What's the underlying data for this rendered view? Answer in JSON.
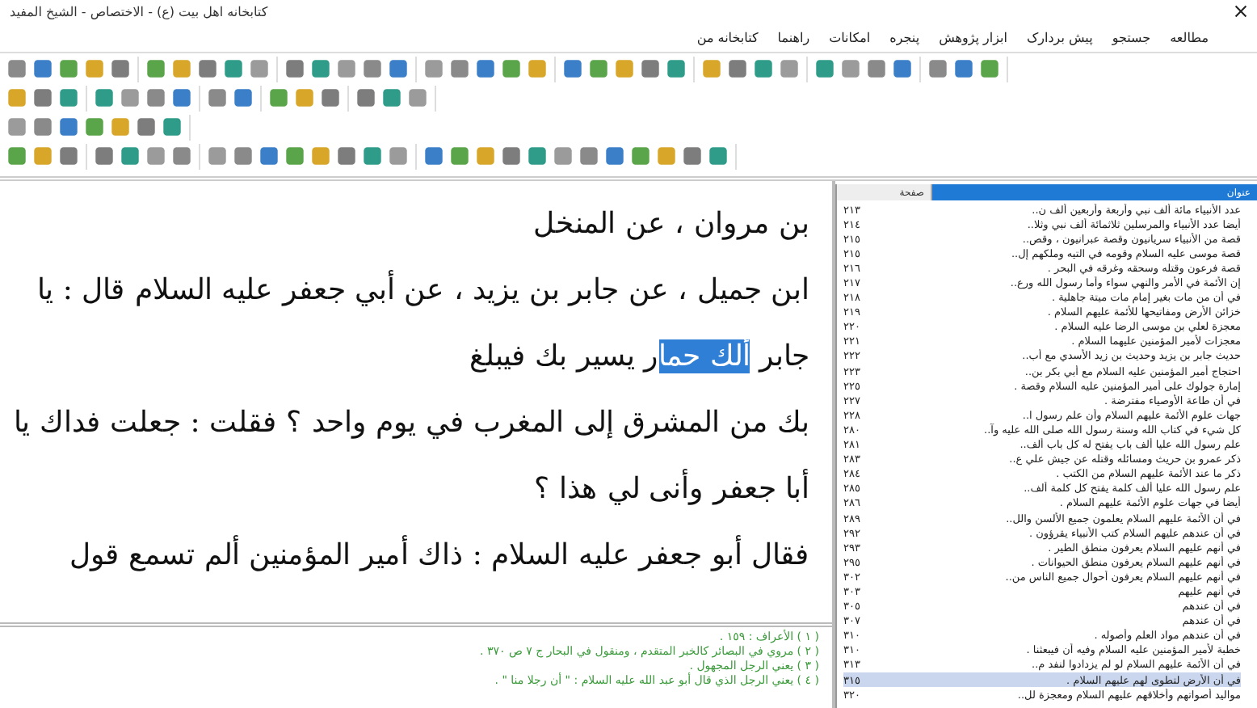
{
  "window": {
    "title": "کتابخانه اهل بیت (ع) - الاختصاص - الشیخ المفید"
  },
  "menu": [
    "مطالعه",
    "جستجو",
    "پیش بردارک",
    "ابزار پژوهش",
    "پنجره",
    "امکانات",
    "راهنما",
    "کتابخانه من"
  ],
  "reader": {
    "lines": [
      [
        {
          "text": "بن مروان ، عن المنخل",
          "selected": false
        }
      ],
      [
        {
          "text": "ابن جميل ، عن جابر بن يزيد ، عن أبي جعفر عليه السلام قال : يا",
          "selected": false
        }
      ],
      [
        {
          "text": "جابر ",
          "selected": false
        },
        {
          "text": "ألك حما",
          "selected": true
        },
        {
          "text": "ر يسير بك فيبلغ",
          "selected": false
        }
      ],
      [
        {
          "text": "بك من المشرق إلى المغرب في يوم واحد ؟ فقلت : جعلت فداك يا",
          "selected": false
        }
      ],
      [
        {
          "text": "أبا جعفر وأنى لي هذا ؟",
          "selected": false
        }
      ],
      [
        {
          "text": "فقال أبو جعفر عليه السلام : ذاك أمير المؤمنين ألم تسمع قول",
          "selected": false
        }
      ]
    ]
  },
  "footnotes": [
    "( ١ ) الأعراف : ١٥٩ .",
    "( ٢ ) مروي في البصائر كالخبر المتقدم ، ومنقول في البحار ج ٧ ص ٣٧٠ .",
    "( ٣ ) يعني الرجل المجهول .",
    "( ٤ ) يعني الرجل الذي قال أبو عبد الله عليه السلام : \" أن رجلا منا \" ."
  ],
  "contents": {
    "columns": [
      "عنوان",
      "صفحة"
    ],
    "rows": [
      {
        "title": "عدد الأنبياء مائة ألف نبي وأربعة وأربعين ألف ن..",
        "page": "٢١٣",
        "selected": false
      },
      {
        "title": "أيضا عدد الأنبياء والمرسلين ثلاثمائة ألف نبي وثلا..",
        "page": "٢١٤",
        "selected": false
      },
      {
        "title": "قصة من الأنبياء سريانيون وقصة عبرانيون ، وقص..",
        "page": "٢١٥",
        "selected": false
      },
      {
        "title": "قصة موسى عليه السلام وقومه في التيه وملكهم إل..",
        "page": "٢١٥",
        "selected": false
      },
      {
        "title": "قصة فرعون وقتله وسحقه وغرقه في البحر .",
        "page": "٢١٦",
        "selected": false
      },
      {
        "title": "إن الأئمة في الأمر والنهي سواء وأما رسول الله ورع..",
        "page": "٢١٧",
        "selected": false
      },
      {
        "title": "في أن من مات بغير إمام مات ميتة جاهلية .",
        "page": "٢١٨",
        "selected": false
      },
      {
        "title": "خزائن الأرض ومفاتيحها للأئمة عليهم السلام .",
        "page": "٢١٩",
        "selected": false
      },
      {
        "title": "معجزة لعلي بن موسى الرضا عليه السلام .",
        "page": "٢٢٠",
        "selected": false
      },
      {
        "title": "معجزات لأمير المؤمنين عليهما السلام .",
        "page": "٢٢١",
        "selected": false
      },
      {
        "title": "حديث جابر بن يزيد وحديث بن زيد الأسدي مع أب..",
        "page": "٢٢٢",
        "selected": false
      },
      {
        "title": "احتجاج أمير المؤمنين عليه السلام مع أبي بكر بن..",
        "page": "٢٢٣",
        "selected": false
      },
      {
        "title": "إمارة جولوك على أمير المؤمنين عليه السلام وقصة .",
        "page": "٢٢٥",
        "selected": false
      },
      {
        "title": "في أن طاعة الأوصياء مفترضة .",
        "page": "٢٢٧",
        "selected": false
      },
      {
        "title": "جهات علوم الأئمة عليهم السلام وأن علم رسول ا..",
        "page": "٢٢٨",
        "selected": false
      },
      {
        "title": "كل شيء في كتاب الله وسنة رسول الله صلى الله عليه وآ..",
        "page": "٢٨٠",
        "selected": false
      },
      {
        "title": "علم رسول الله عليا ألف باب يفتح له كل باب ألف..",
        "page": "٢٨١",
        "selected": false
      },
      {
        "title": "ذكر عمرو بن حريث ومسائله وقتله عن جيش علي ع..",
        "page": "٢٨٣",
        "selected": false
      },
      {
        "title": "ذكر ما عند الأئمة عليهم السلام من الكتب .",
        "page": "٢٨٤",
        "selected": false
      },
      {
        "title": "علم رسول الله عليا ألف كلمة يفتح كل كلمة ألف..",
        "page": "٢٨٥",
        "selected": false
      },
      {
        "title": "أيضا في جهات علوم الأئمة عليهم السلام .",
        "page": "٢٨٦",
        "selected": false
      },
      {
        "title": "في أن الأئمة عليهم السلام يعلمون جميع الألسن والل..",
        "page": "٢٨٩",
        "selected": false
      },
      {
        "title": "في أن عندهم عليهم السلام كتب الأنبياء يقرؤون .",
        "page": "٢٩٢",
        "selected": false
      },
      {
        "title": "في أنهم عليهم السلام يعرفون منطق الطير .",
        "page": "٢٩٣",
        "selected": false
      },
      {
        "title": "في أنهم عليهم السلام يعرفون منطق الحيوانات .",
        "page": "٢٩٥",
        "selected": false
      },
      {
        "title": "في أنهم عليهم السلام يعرفون أحوال جميع الناس من..",
        "page": "٣٠٢",
        "selected": false
      },
      {
        "title": "في أنهم عليهم",
        "page": "٣٠٣",
        "selected": false
      },
      {
        "title": "في أن عندهم",
        "page": "٣٠٥",
        "selected": false
      },
      {
        "title": "في أن عندهم",
        "page": "٣٠٧",
        "selected": false
      },
      {
        "title": "في أن عندهم مواد العلم وأصوله .",
        "page": "٣١٠",
        "selected": false
      },
      {
        "title": "خطبة لأمير المؤمنين عليه السلام وفيه أن فيبعثنا .",
        "page": "٣١٠",
        "selected": false
      },
      {
        "title": "في أن الأئمة عليهم السلام لو لم يزدادوا لنفد م..",
        "page": "٣١٣",
        "selected": false
      },
      {
        "title": "في أن الأرض لتطوى لهم عليهم السلام .",
        "page": "٣١٥",
        "selected": true
      },
      {
        "title": "مواليد أصواتهم وأخلاقهم عليهم السلام ومعجزة لل..",
        "page": "٣٢٠",
        "selected": false
      }
    ]
  }
}
